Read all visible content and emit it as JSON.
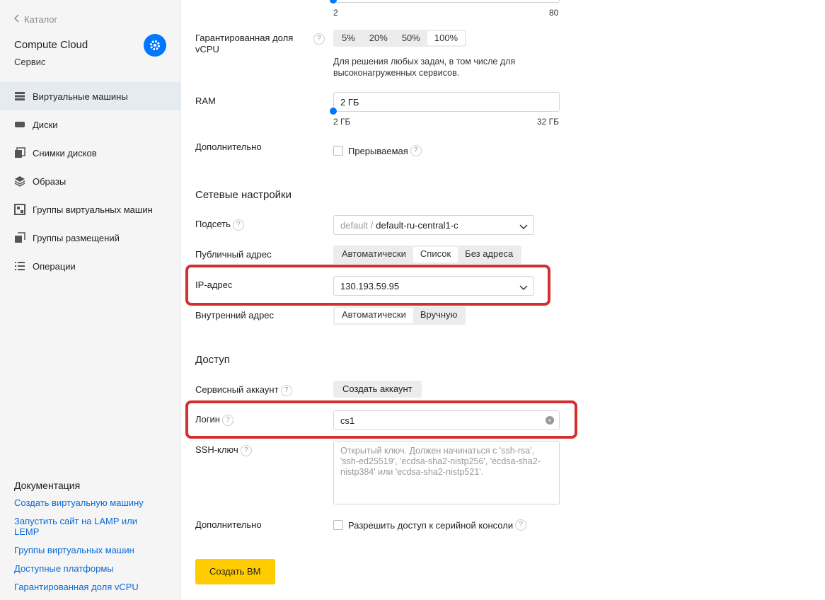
{
  "sidebar": {
    "back_label": "Каталог",
    "service_title": "Compute Cloud",
    "service_sub": "Сервис",
    "items": [
      {
        "label": "Виртуальные машины",
        "icon": "server-icon",
        "active": true
      },
      {
        "label": "Диски",
        "icon": "disk-icon"
      },
      {
        "label": "Снимки дисков",
        "icon": "snapshot-icon"
      },
      {
        "label": "Образы",
        "icon": "layers-icon"
      },
      {
        "label": "Группы виртуальных машин",
        "icon": "group-icon"
      },
      {
        "label": "Группы размещений",
        "icon": "placement-icon"
      },
      {
        "label": "Операции",
        "icon": "list-icon"
      }
    ],
    "docs_title": "Документация",
    "docs": [
      "Создать виртуальную машину",
      "Запустить сайт на LAMP или LEMP",
      "Группы виртуальных машин",
      "Доступные платформы",
      "Гарантированная доля vCPU"
    ]
  },
  "form": {
    "vcpu_slider": {
      "min": "2",
      "max": "80"
    },
    "vcpu_share": {
      "label": "Гарантированная доля vCPU",
      "options": [
        "5%",
        "20%",
        "50%",
        "100%"
      ],
      "selected": "100%",
      "hint": "Для решения любых задач, в том числе для высоконагруженных сервисов."
    },
    "ram": {
      "label": "RAM",
      "value": "2 ГБ",
      "min": "2 ГБ",
      "max": "32 ГБ"
    },
    "extra1": {
      "label": "Дополнительно",
      "checkbox": "Прерываемая"
    },
    "network_title": "Сетевые настройки",
    "subnet": {
      "label": "Подсеть",
      "prefix": "default /",
      "value": "default-ru-central1-c"
    },
    "public_addr": {
      "label": "Публичный адрес",
      "options": [
        "Автоматически",
        "Список",
        "Без адреса"
      ],
      "selected": "Список"
    },
    "ip": {
      "label": "IP-адрес",
      "value": "130.193.59.95"
    },
    "internal_addr": {
      "label": "Внутренний адрес",
      "options": [
        "Автоматически",
        "Вручную"
      ],
      "selected": "Автоматически"
    },
    "access_title": "Доступ",
    "service_account": {
      "label": "Сервисный аккаунт",
      "button": "Создать аккаунт"
    },
    "login": {
      "label": "Логин",
      "value": "cs1"
    },
    "ssh": {
      "label": "SSH-ключ",
      "placeholder": "Открытый ключ. Должен начинаться с 'ssh-rsa', 'ssh-ed25519', 'ecdsa-sha2-nistp256', 'ecdsa-sha2-nistp384' или 'ecdsa-sha2-nistp521'."
    },
    "extra2": {
      "label": "Дополнительно",
      "checkbox": "Разрешить доступ к серийной консоли"
    },
    "submit": "Создать ВМ"
  },
  "colors": {
    "accent": "#0077ff",
    "highlight": "#d32f2f",
    "primary_button": "#ffcc00"
  }
}
